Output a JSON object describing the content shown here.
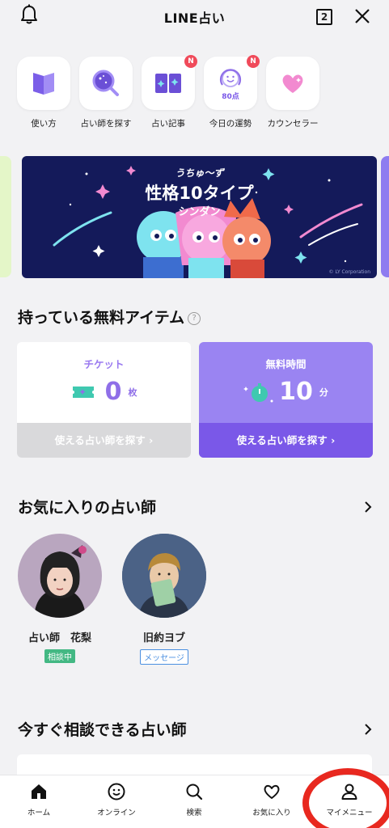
{
  "header": {
    "title": "LINE占い",
    "tab_count": "2",
    "bell_icon": "bell-icon",
    "close_icon": "close-icon"
  },
  "quick_menu": [
    {
      "label": "使い方",
      "icon": "book-icon",
      "badge": ""
    },
    {
      "label": "占い師を探す",
      "icon": "crystal-ball-search-icon",
      "badge": ""
    },
    {
      "label": "占い記事",
      "icon": "open-book-sparkle-icon",
      "badge": "N"
    },
    {
      "label": "今日の運勢",
      "icon": "fortune-score-icon",
      "badge": "N",
      "score": "80点"
    },
    {
      "label": "カウンセラー",
      "icon": "heart-icon",
      "badge": ""
    }
  ],
  "banner": {
    "subtitle": "うちゅ〜ず",
    "title": "性格10タイプ",
    "title2": "シンダン",
    "copyright": "© LY Corporation"
  },
  "free_items": {
    "title": "持っている無料アイテム",
    "help_icon": "?",
    "ticket": {
      "heading": "チケット",
      "value": "0",
      "unit": "枚",
      "button": "使える占い師を探す ›"
    },
    "free_time": {
      "heading": "無料時間",
      "value": "10",
      "unit": "分",
      "button": "使える占い師を探す ›"
    }
  },
  "favorites": {
    "title": "お気に入りの占い師",
    "items": [
      {
        "name": "占い師　花梨",
        "status": "相談中"
      },
      {
        "name": "旧約ヨブ",
        "status": "メッセージ"
      }
    ]
  },
  "available_now": {
    "title": "今すぐ相談できる占い師"
  },
  "bottom_nav": [
    {
      "label": "ホーム",
      "icon": "home-icon"
    },
    {
      "label": "オンライン",
      "icon": "smile-icon"
    },
    {
      "label": "検索",
      "icon": "search-icon"
    },
    {
      "label": "お気に入り",
      "icon": "heart-outline-icon"
    },
    {
      "label": "マイメニュー",
      "icon": "person-icon"
    }
  ],
  "colors": {
    "accent_purple": "#8f6fe8",
    "free_card": "#9a84f2",
    "free_button": "#7a58e8",
    "badge_red": "#f04a5a",
    "status_green": "#43b883",
    "annotation_red": "#e8281f"
  }
}
